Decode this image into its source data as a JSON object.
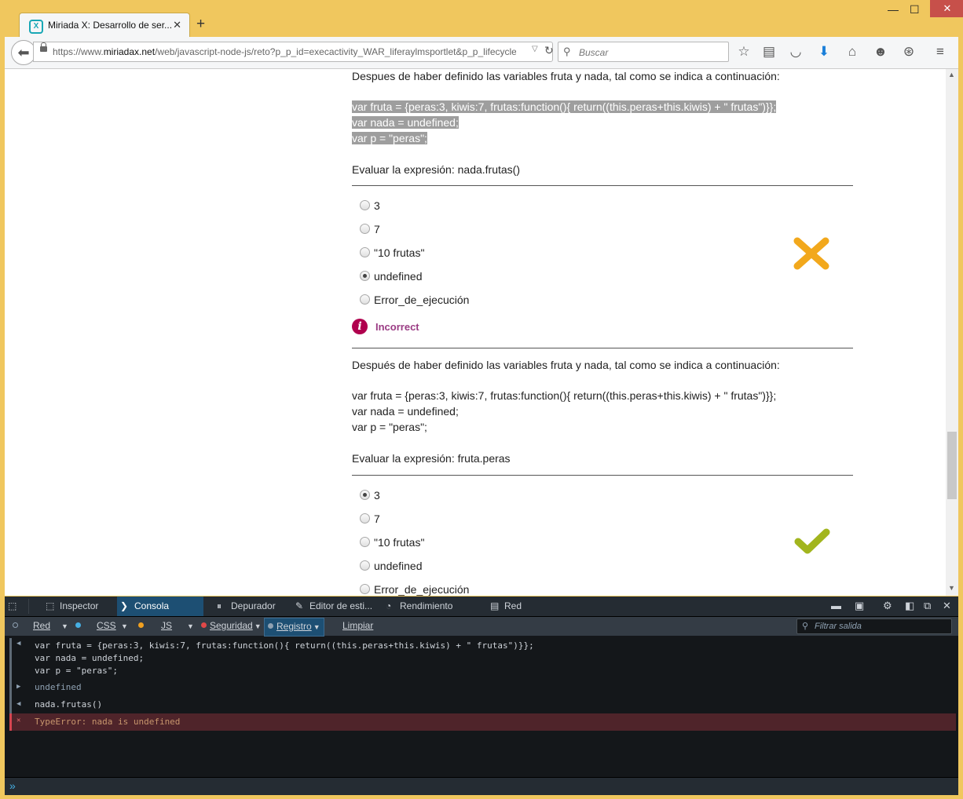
{
  "browser": {
    "tab_title": "Miriada X: Desarrollo de ser...",
    "tab_close": "✕",
    "new_tab": "+",
    "url_prefix": "https://www.",
    "url_host": "miriadax.net",
    "url_rest": "/web/javascript-node-js/reto?p_p_id=execactivity_WAR_liferaylmsportlet&p_p_lifecycle",
    "search_placeholder": "Buscar",
    "window_controls": [
      "—",
      "☐",
      "✕"
    ],
    "toolbar_icons": [
      "star-icon",
      "reading-list-icon",
      "pocket-icon",
      "download-icon",
      "home-icon",
      "chat-icon",
      "hello-icon",
      "menu-icon"
    ]
  },
  "page": {
    "q1": {
      "intro": "Despues de haber definido las variables fruta y nada, tal como se indica a continuación:",
      "code": [
        "var fruta = {peras:3, kiwis:7, frutas:function(){ return((this.peras+this.kiwis) + \" frutas\")}};",
        "var nada = undefined;",
        "var p = \"peras\";"
      ],
      "expression": "Evaluar la expresión: nada.frutas()",
      "options": [
        "3",
        "7",
        "\"10 frutas\"",
        "undefined",
        "Error_de_ejecución"
      ],
      "selected_index": 3,
      "result": "incorrect",
      "feedback_label": "Incorrect",
      "cross_color": "#f2a81c"
    },
    "q2": {
      "intro": "Después de haber definido las variables fruta y nada, tal como se indica a continuación:",
      "code": [
        "var fruta = {peras:3, kiwis:7, frutas:function(){ return((this.peras+this.kiwis) + \" frutas\")}};",
        "var nada = undefined;",
        "var p = \"peras\";"
      ],
      "expression": "Evaluar la expresión: fruta.peras",
      "options": [
        "3",
        "7",
        "\"10 frutas\"",
        "undefined",
        "Error_de_ejecución"
      ],
      "selected_index": 0,
      "result": "correct",
      "check_color": "#a2b51e"
    }
  },
  "devtools": {
    "tabs": [
      "Inspector",
      "Consola",
      "Depurador",
      "Editor de esti...",
      "Rendimiento",
      "Red"
    ],
    "active_tab": "Consola",
    "filters": {
      "red": "Red",
      "css": "CSS",
      "js": "JS",
      "seguridad": "Seguridad",
      "registro": "Registro",
      "limpiar": "Limpiar"
    },
    "filter_placeholder": "Filtrar salida",
    "colors": {
      "red": "#5e6a76",
      "css": "#46afe3",
      "js": "#f0a020",
      "seguridad": "#e04848",
      "registro": "#8fa1b2"
    },
    "console": {
      "input1": "var fruta = {peras:3, kiwis:7, frutas:function(){ return((this.peras+this.kiwis) + \" frutas\")}};\nvar nada = undefined;\nvar p = \"peras\";",
      "output1": "undefined",
      "input2": "nada.frutas()",
      "error": "TypeError: nada is undefined"
    }
  }
}
